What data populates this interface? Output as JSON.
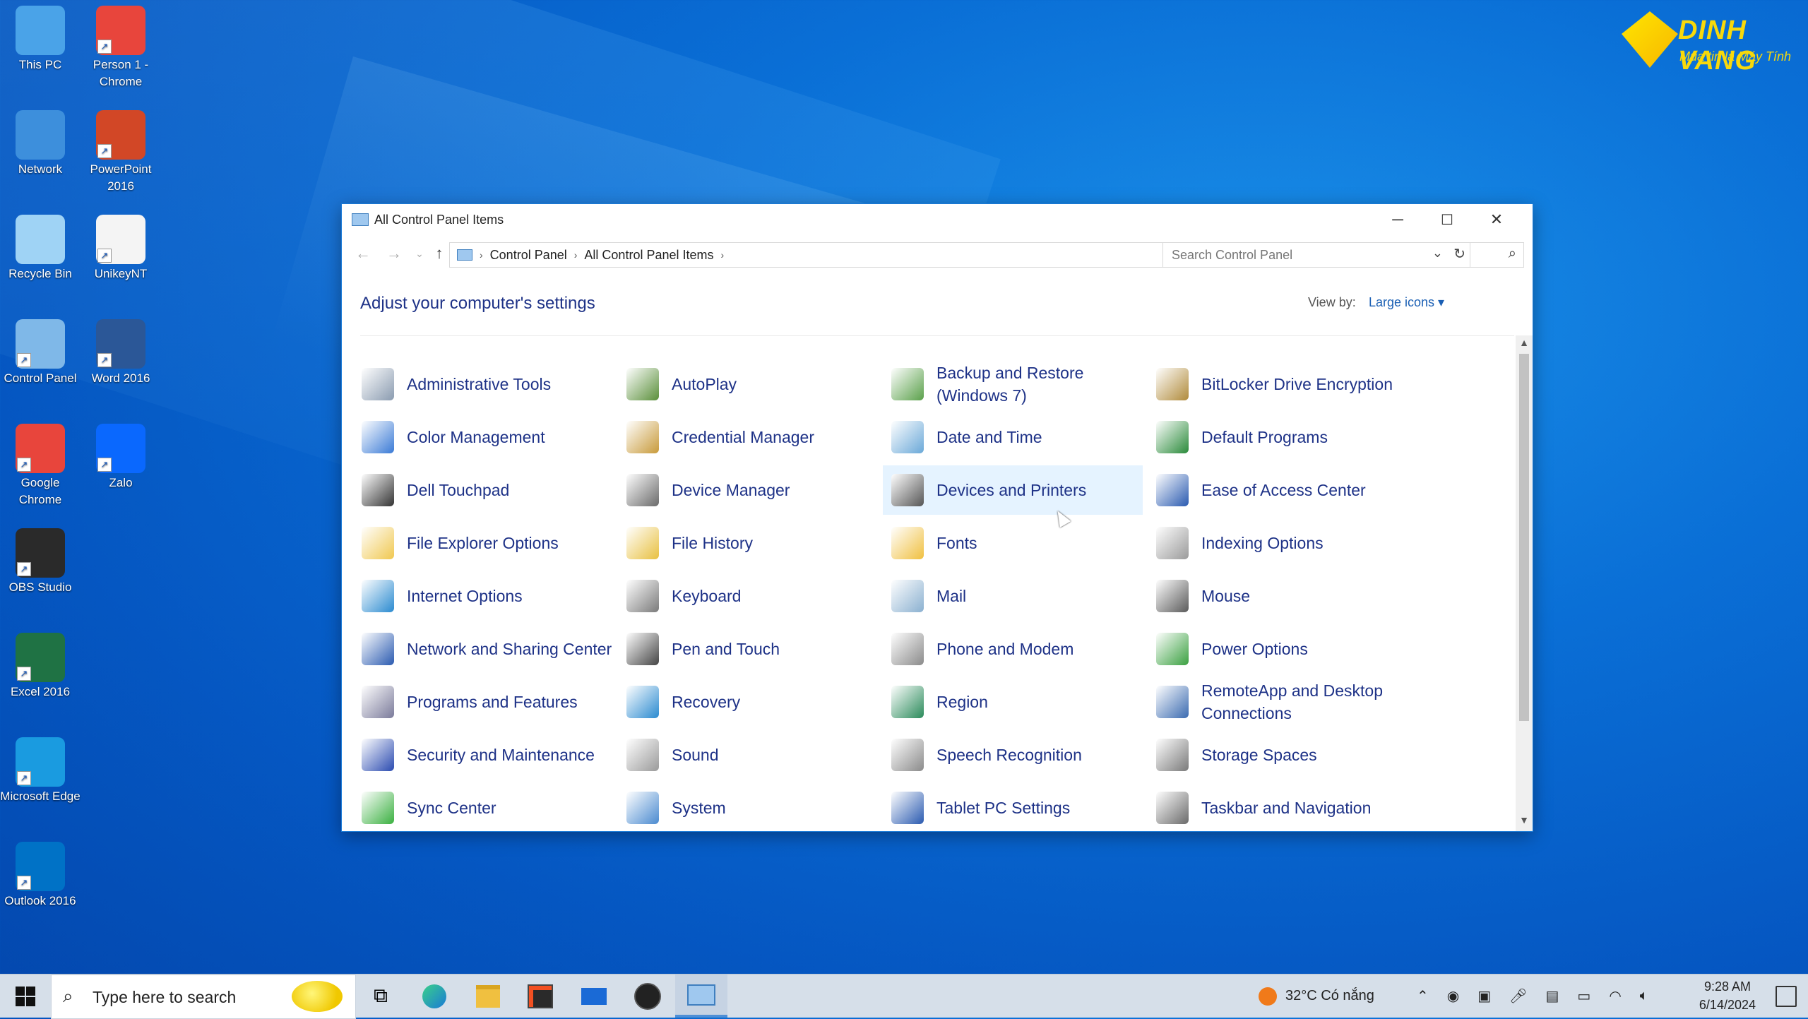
{
  "desktop": {
    "icons": [
      {
        "label": "This PC",
        "color": "#4aa3e8"
      },
      {
        "label": "Person 1 - Chrome",
        "color": "#e8453c"
      },
      {
        "label": "Network",
        "color": "#3d8fdc"
      },
      {
        "label": "PowerPoint 2016",
        "color": "#d24726"
      },
      {
        "label": "Recycle Bin",
        "color": "#9fd3f5"
      },
      {
        "label": "UnikeyNT",
        "color": "#f4f4f4"
      },
      {
        "label": "Control Panel",
        "color": "#7fb8e8"
      },
      {
        "label": "Word 2016",
        "color": "#2b5797"
      },
      {
        "label": "Google Chrome",
        "color": "#e8453c"
      },
      {
        "label": "Zalo",
        "color": "#0a68fe"
      },
      {
        "label": "OBS Studio",
        "color": "#2a2a2a"
      },
      {
        "label": "Excel 2016",
        "color": "#1f7244"
      },
      {
        "label": "Microsoft Edge",
        "color": "#1a9be0"
      },
      {
        "label": "Outlook 2016",
        "color": "#0072c6"
      }
    ],
    "logo": {
      "brand": "DINH VANG",
      "tagline": "Mua tin là Máy Tính"
    }
  },
  "window": {
    "title": "All Control Panel Items",
    "minimize": "─",
    "maximize": "☐",
    "close": "✕",
    "breadcrumb": [
      "Control Panel",
      "All Control Panel Items"
    ],
    "search_placeholder": "Search Control Panel",
    "heading": "Adjust your computer's settings",
    "view_by_label": "View by:",
    "view_by_value": "Large icons ▾",
    "items": [
      {
        "label": "Administrative Tools",
        "icon": "admin-tools-icon",
        "color": "#8a9bb0"
      },
      {
        "label": "AutoPlay",
        "icon": "autoplay-icon",
        "color": "#5a8f3a"
      },
      {
        "label": "Backup and Restore (Windows 7)",
        "icon": "backup-icon",
        "color": "#5aa04a"
      },
      {
        "label": "BitLocker Drive Encryption",
        "icon": "bitlocker-icon",
        "color": "#b08a3a"
      },
      {
        "label": "Color Management",
        "icon": "color-management-icon",
        "color": "#3a7ad6"
      },
      {
        "label": "Credential Manager",
        "icon": "credential-icon",
        "color": "#c89a3a"
      },
      {
        "label": "Date and Time",
        "icon": "clock-icon",
        "color": "#6aa8d8"
      },
      {
        "label": "Default Programs",
        "icon": "default-programs-icon",
        "color": "#2a8a3a"
      },
      {
        "label": "Dell Touchpad",
        "icon": "touchpad-icon",
        "color": "#333333"
      },
      {
        "label": "Device Manager",
        "icon": "device-manager-icon",
        "color": "#6a6a6a"
      },
      {
        "label": "Devices and Printers",
        "icon": "printer-icon",
        "color": "#555555"
      },
      {
        "label": "Ease of Access Center",
        "icon": "ease-of-access-icon",
        "color": "#2a5ab0"
      },
      {
        "label": "File Explorer Options",
        "icon": "folder-options-icon",
        "color": "#f0c850"
      },
      {
        "label": "File History",
        "icon": "file-history-icon",
        "color": "#e8c040"
      },
      {
        "label": "Fonts",
        "icon": "fonts-icon",
        "color": "#f0c040"
      },
      {
        "label": "Indexing Options",
        "icon": "indexing-icon",
        "color": "#9a9a9a"
      },
      {
        "label": "Internet Options",
        "icon": "internet-options-icon",
        "color": "#2a8ad0"
      },
      {
        "label": "Keyboard",
        "icon": "keyboard-icon",
        "color": "#7a7a7a"
      },
      {
        "label": "Mail",
        "icon": "mail-icon",
        "color": "#8ab0d0"
      },
      {
        "label": "Mouse",
        "icon": "mouse-icon",
        "color": "#5a5a5a"
      },
      {
        "label": "Network and Sharing Center",
        "icon": "network-icon",
        "color": "#2a5ab0"
      },
      {
        "label": "Pen and Touch",
        "icon": "pen-icon",
        "color": "#444444"
      },
      {
        "label": "Phone and Modem",
        "icon": "phone-modem-icon",
        "color": "#8a8a8a"
      },
      {
        "label": "Power Options",
        "icon": "power-icon",
        "color": "#3aa040"
      },
      {
        "label": "Programs and Features",
        "icon": "programs-icon",
        "color": "#7a7a9a"
      },
      {
        "label": "Recovery",
        "icon": "recovery-icon",
        "color": "#2a8ad0"
      },
      {
        "label": "Region",
        "icon": "region-icon",
        "color": "#2a8a5a"
      },
      {
        "label": "RemoteApp and Desktop Connections",
        "icon": "remoteapp-icon",
        "color": "#3a6ab0"
      },
      {
        "label": "Security and Maintenance",
        "icon": "flag-icon",
        "color": "#2a4ab0"
      },
      {
        "label": "Sound",
        "icon": "sound-icon",
        "color": "#9a9a9a"
      },
      {
        "label": "Speech Recognition",
        "icon": "microphone-icon",
        "color": "#8a8a8a"
      },
      {
        "label": "Storage Spaces",
        "icon": "storage-icon",
        "color": "#7a7a7a"
      },
      {
        "label": "Sync Center",
        "icon": "sync-icon",
        "color": "#3ab040"
      },
      {
        "label": "System",
        "icon": "system-icon",
        "color": "#4a8ad0"
      },
      {
        "label": "Tablet PC Settings",
        "icon": "tablet-icon",
        "color": "#2a5ab0"
      },
      {
        "label": "Taskbar and Navigation",
        "icon": "taskbar-icon",
        "color": "#6a6a6a"
      }
    ],
    "highlighted_item": "Devices and Printers"
  },
  "taskbar": {
    "search_placeholder": "Type here to search",
    "apps": [
      "task-view-icon",
      "edge-icon",
      "file-explorer-icon",
      "store-icon",
      "mail-icon",
      "obs-icon",
      "control-panel-icon"
    ],
    "weather": "32°C  Có nắng",
    "time": "9:28 AM",
    "date": "6/14/2024"
  }
}
